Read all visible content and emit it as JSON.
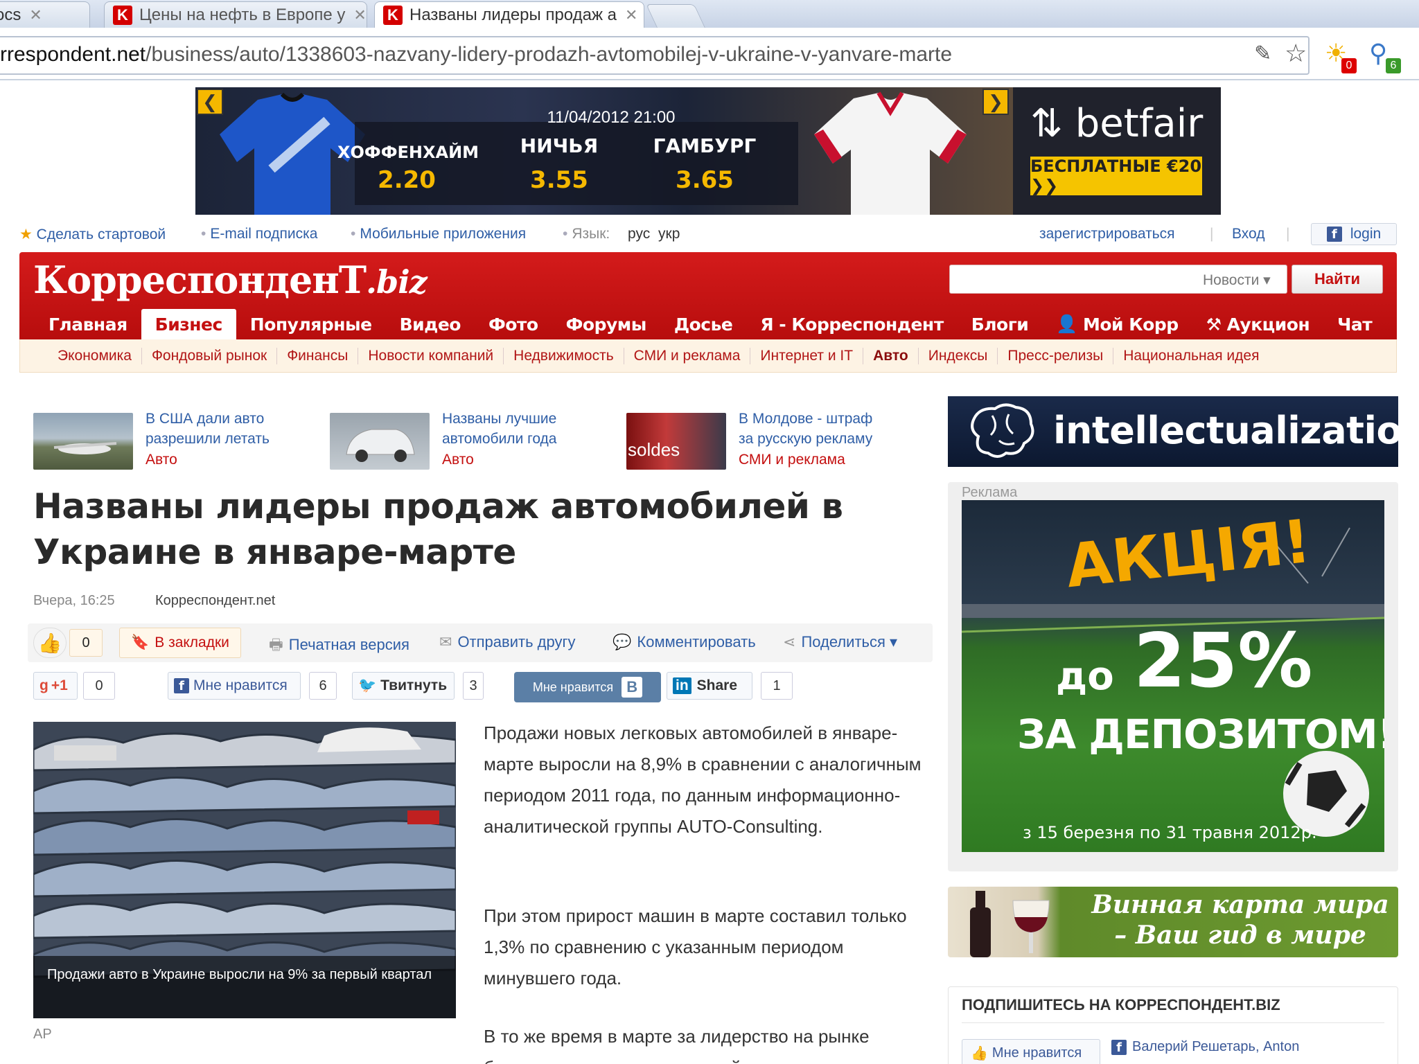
{
  "browser": {
    "tabs": [
      {
        "label": "ocs",
        "favicon": ""
      },
      {
        "label": "Цены на нефть в Европе у",
        "favicon": "K"
      },
      {
        "label": "Названы лидеры продаж а",
        "favicon": "K"
      }
    ],
    "url_host": "rrespondent.net",
    "url_path": "/business/auto/1338603-nazvany-lidery-prodazh-avtomobilej-v-ukraine-v-yanvare-marte",
    "ext_badge_1": "0",
    "ext_badge_2": "6"
  },
  "banner": {
    "date": "11/04/2012 21:00",
    "home_team": "ХОФФЕНХАЙМ",
    "home_odds": "2.20",
    "draw_label": "НИЧЬЯ",
    "draw_odds": "3.55",
    "away_team": "ГАМБУРГ",
    "away_odds": "3.65",
    "brand": "betfair",
    "cta": "БЕСПЛАТНЫЕ €20 ❯❯",
    "prev": "❮",
    "next": "❯"
  },
  "utility": {
    "make_start": "Сделать стартовой",
    "email_sub": "E-mail подписка",
    "mobile_apps": "Мобильные приложения",
    "lang_label": "Язык:",
    "lang_ru": "рус",
    "lang_ua": "укр",
    "register": "зарегистрироваться",
    "login": "Вход",
    "fb_login": "login"
  },
  "header": {
    "logo_main": "КорреспонденТ",
    "logo_biz": ".biz",
    "search_placeholder": "",
    "search_scope": "Новости ▾",
    "search_button": "Найти"
  },
  "nav": {
    "items": [
      {
        "label": "Главная",
        "active": false
      },
      {
        "label": "Бизнес",
        "active": true
      },
      {
        "label": "Популярные",
        "active": false
      },
      {
        "label": "Видео",
        "active": false
      },
      {
        "label": "Фото",
        "active": false
      },
      {
        "label": "Форумы",
        "active": false
      },
      {
        "label": "Досье",
        "active": false
      },
      {
        "label": "Я - Корреспондент",
        "active": false
      },
      {
        "label": "Блоги",
        "active": false
      },
      {
        "label": "Мой Корр",
        "active": false
      },
      {
        "label": "Аукцион",
        "active": false
      },
      {
        "label": "Чат",
        "active": false
      }
    ],
    "sub": [
      {
        "label": "Экономика",
        "active": false
      },
      {
        "label": "Фондовый рынок",
        "active": false
      },
      {
        "label": "Финансы",
        "active": false
      },
      {
        "label": "Новости компаний",
        "active": false
      },
      {
        "label": "Недвижимость",
        "active": false
      },
      {
        "label": "СМИ и реклама",
        "active": false
      },
      {
        "label": "Интернет и IT",
        "active": false
      },
      {
        "label": "Авто",
        "active": true
      },
      {
        "label": "Индексы",
        "active": false
      },
      {
        "label": "Пресс-релизы",
        "active": false
      },
      {
        "label": "Национальная идея",
        "active": false
      }
    ]
  },
  "related": [
    {
      "title": "В США дали авто разрешили летать",
      "category": "Авто"
    },
    {
      "title": "Названы лучшие автомобили года",
      "category": "Авто"
    },
    {
      "title": "В Молдове - штраф за русскую рекламу",
      "category": "СМИ и реклама",
      "thumb_text": "soldes"
    }
  ],
  "article": {
    "headline": "Названы лидеры продаж автомобилей в Украине в январе-марте",
    "date": "Вчера, 16:25",
    "source": "Корреспондент.net",
    "like_count": "0",
    "bookmark": "В закладки",
    "print": "Печатная версия",
    "send": "Отправить другу",
    "comment": "Комментировать",
    "share": "Поделиться ▾",
    "gplus_label": "+1",
    "gplus_count": "0",
    "fb_like": "Мне нравится",
    "fb_count": "6",
    "tweet": "Твитнуть",
    "tweet_count": "3",
    "vk_like": "Мне нравится",
    "vk_logo": "В",
    "in_share": "Share",
    "in_logo": "in",
    "in_count": "1",
    "photo_caption": "Продажи авто в Украине выросли на 9% за первый квартал",
    "photo_credit": "AP",
    "paragraphs": [
      "Продажи новых легковых автомобилей в январе-марте выросли на 8,9% в сравнении с аналогичным периодом 2011 года, по данным информационно-аналитической группы AUTO-Consulting.",
      "При этом прирост машин в марте составил только 1,3% по сравнению с указанным периодом минувшего года.",
      "В то же время в марте за лидерство на рынке боролись сразу пять компаний, при этом с"
    ]
  },
  "sidebar": {
    "intel_banner": "intellectualization",
    "ad_label": "Реклама",
    "ad_title": "АКЦІЯ!",
    "ad_prefix": "до",
    "ad_percent": "25%",
    "ad_sub": "ЗА ДЕПОЗИТОМ!",
    "ad_dates": "з 15 березня по 31 травня 2012р.",
    "wine_text": "Винная карта мира – Ваш гид в мире вина",
    "subscribe_title": "ПОДПИШИТЕСЬ НА КОРРЕСПОНДЕНТ.BIZ",
    "fb_like": "Мне нравится",
    "friends": "Валерий Решетарь, Anton"
  },
  "colors": {
    "brand_red": "#c40f0f",
    "link_blue": "#2f5ea6",
    "betfair_yellow": "#f5c400"
  }
}
